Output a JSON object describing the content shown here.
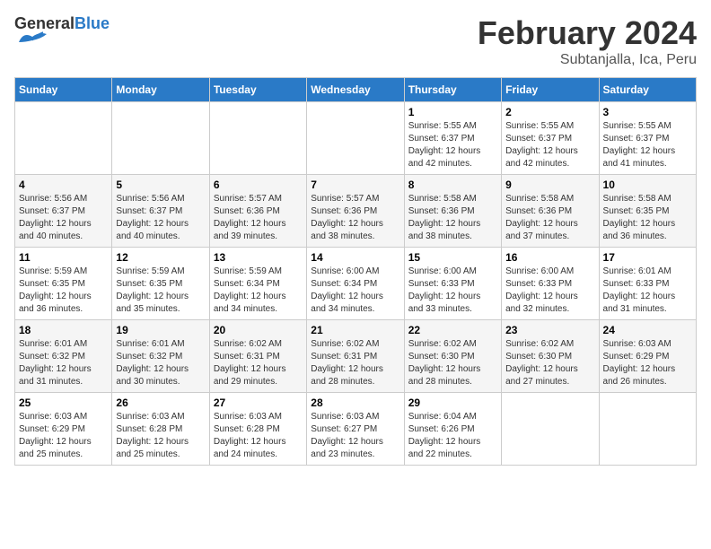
{
  "header": {
    "logo_general": "General",
    "logo_blue": "Blue",
    "month_title": "February 2024",
    "subtitle": "Subtanjalla, Ica, Peru"
  },
  "days_of_week": [
    "Sunday",
    "Monday",
    "Tuesday",
    "Wednesday",
    "Thursday",
    "Friday",
    "Saturday"
  ],
  "weeks": [
    [
      {
        "day": "",
        "sunrise": "",
        "sunset": "",
        "daylight": "",
        "empty": true
      },
      {
        "day": "",
        "sunrise": "",
        "sunset": "",
        "daylight": "",
        "empty": true
      },
      {
        "day": "",
        "sunrise": "",
        "sunset": "",
        "daylight": "",
        "empty": true
      },
      {
        "day": "",
        "sunrise": "",
        "sunset": "",
        "daylight": "",
        "empty": true
      },
      {
        "day": "1",
        "sunrise": "Sunrise: 5:55 AM",
        "sunset": "Sunset: 6:37 PM",
        "daylight": "Daylight: 12 hours and 42 minutes."
      },
      {
        "day": "2",
        "sunrise": "Sunrise: 5:55 AM",
        "sunset": "Sunset: 6:37 PM",
        "daylight": "Daylight: 12 hours and 42 minutes."
      },
      {
        "day": "3",
        "sunrise": "Sunrise: 5:55 AM",
        "sunset": "Sunset: 6:37 PM",
        "daylight": "Daylight: 12 hours and 41 minutes."
      }
    ],
    [
      {
        "day": "4",
        "sunrise": "Sunrise: 5:56 AM",
        "sunset": "Sunset: 6:37 PM",
        "daylight": "Daylight: 12 hours and 40 minutes."
      },
      {
        "day": "5",
        "sunrise": "Sunrise: 5:56 AM",
        "sunset": "Sunset: 6:37 PM",
        "daylight": "Daylight: 12 hours and 40 minutes."
      },
      {
        "day": "6",
        "sunrise": "Sunrise: 5:57 AM",
        "sunset": "Sunset: 6:36 PM",
        "daylight": "Daylight: 12 hours and 39 minutes."
      },
      {
        "day": "7",
        "sunrise": "Sunrise: 5:57 AM",
        "sunset": "Sunset: 6:36 PM",
        "daylight": "Daylight: 12 hours and 38 minutes."
      },
      {
        "day": "8",
        "sunrise": "Sunrise: 5:58 AM",
        "sunset": "Sunset: 6:36 PM",
        "daylight": "Daylight: 12 hours and 38 minutes."
      },
      {
        "day": "9",
        "sunrise": "Sunrise: 5:58 AM",
        "sunset": "Sunset: 6:36 PM",
        "daylight": "Daylight: 12 hours and 37 minutes."
      },
      {
        "day": "10",
        "sunrise": "Sunrise: 5:58 AM",
        "sunset": "Sunset: 6:35 PM",
        "daylight": "Daylight: 12 hours and 36 minutes."
      }
    ],
    [
      {
        "day": "11",
        "sunrise": "Sunrise: 5:59 AM",
        "sunset": "Sunset: 6:35 PM",
        "daylight": "Daylight: 12 hours and 36 minutes."
      },
      {
        "day": "12",
        "sunrise": "Sunrise: 5:59 AM",
        "sunset": "Sunset: 6:35 PM",
        "daylight": "Daylight: 12 hours and 35 minutes."
      },
      {
        "day": "13",
        "sunrise": "Sunrise: 5:59 AM",
        "sunset": "Sunset: 6:34 PM",
        "daylight": "Daylight: 12 hours and 34 minutes."
      },
      {
        "day": "14",
        "sunrise": "Sunrise: 6:00 AM",
        "sunset": "Sunset: 6:34 PM",
        "daylight": "Daylight: 12 hours and 34 minutes."
      },
      {
        "day": "15",
        "sunrise": "Sunrise: 6:00 AM",
        "sunset": "Sunset: 6:33 PM",
        "daylight": "Daylight: 12 hours and 33 minutes."
      },
      {
        "day": "16",
        "sunrise": "Sunrise: 6:00 AM",
        "sunset": "Sunset: 6:33 PM",
        "daylight": "Daylight: 12 hours and 32 minutes."
      },
      {
        "day": "17",
        "sunrise": "Sunrise: 6:01 AM",
        "sunset": "Sunset: 6:33 PM",
        "daylight": "Daylight: 12 hours and 31 minutes."
      }
    ],
    [
      {
        "day": "18",
        "sunrise": "Sunrise: 6:01 AM",
        "sunset": "Sunset: 6:32 PM",
        "daylight": "Daylight: 12 hours and 31 minutes."
      },
      {
        "day": "19",
        "sunrise": "Sunrise: 6:01 AM",
        "sunset": "Sunset: 6:32 PM",
        "daylight": "Daylight: 12 hours and 30 minutes."
      },
      {
        "day": "20",
        "sunrise": "Sunrise: 6:02 AM",
        "sunset": "Sunset: 6:31 PM",
        "daylight": "Daylight: 12 hours and 29 minutes."
      },
      {
        "day": "21",
        "sunrise": "Sunrise: 6:02 AM",
        "sunset": "Sunset: 6:31 PM",
        "daylight": "Daylight: 12 hours and 28 minutes."
      },
      {
        "day": "22",
        "sunrise": "Sunrise: 6:02 AM",
        "sunset": "Sunset: 6:30 PM",
        "daylight": "Daylight: 12 hours and 28 minutes."
      },
      {
        "day": "23",
        "sunrise": "Sunrise: 6:02 AM",
        "sunset": "Sunset: 6:30 PM",
        "daylight": "Daylight: 12 hours and 27 minutes."
      },
      {
        "day": "24",
        "sunrise": "Sunrise: 6:03 AM",
        "sunset": "Sunset: 6:29 PM",
        "daylight": "Daylight: 12 hours and 26 minutes."
      }
    ],
    [
      {
        "day": "25",
        "sunrise": "Sunrise: 6:03 AM",
        "sunset": "Sunset: 6:29 PM",
        "daylight": "Daylight: 12 hours and 25 minutes."
      },
      {
        "day": "26",
        "sunrise": "Sunrise: 6:03 AM",
        "sunset": "Sunset: 6:28 PM",
        "daylight": "Daylight: 12 hours and 25 minutes."
      },
      {
        "day": "27",
        "sunrise": "Sunrise: 6:03 AM",
        "sunset": "Sunset: 6:28 PM",
        "daylight": "Daylight: 12 hours and 24 minutes."
      },
      {
        "day": "28",
        "sunrise": "Sunrise: 6:03 AM",
        "sunset": "Sunset: 6:27 PM",
        "daylight": "Daylight: 12 hours and 23 minutes."
      },
      {
        "day": "29",
        "sunrise": "Sunrise: 6:04 AM",
        "sunset": "Sunset: 6:26 PM",
        "daylight": "Daylight: 12 hours and 22 minutes."
      },
      {
        "day": "",
        "sunrise": "",
        "sunset": "",
        "daylight": "",
        "empty": true
      },
      {
        "day": "",
        "sunrise": "",
        "sunset": "",
        "daylight": "",
        "empty": true
      }
    ]
  ]
}
